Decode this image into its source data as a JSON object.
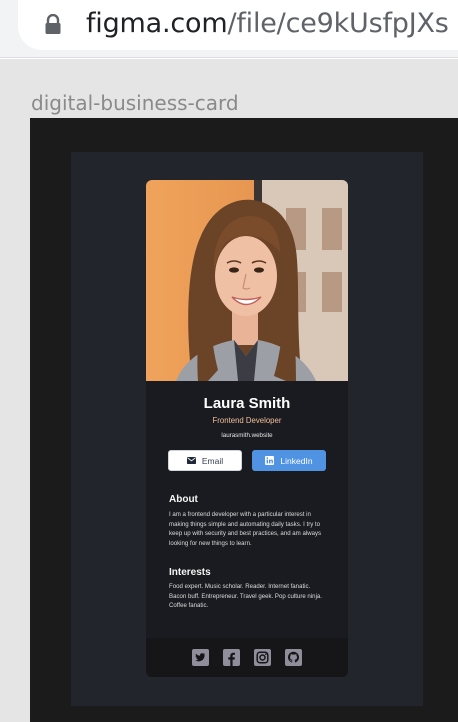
{
  "browser": {
    "url_host": "figma.com",
    "url_path": "/file/ce9kUsfpJXs"
  },
  "figma": {
    "frame_label": "digital-business-card"
  },
  "card": {
    "name": "Laura Smith",
    "title": "Frontend Developer",
    "website": "laurasmith.website",
    "email_label": "Email",
    "linkedin_label": "LinkedIn",
    "about_heading": "About",
    "about_text": "I am a frontend developer with a particular interest in making things simple and automating daily tasks. I try to keep up with security and best practices, and am always looking for new things to learn.",
    "interests_heading": "Interests",
    "interests_text": "Food expert. Music scholar. Reader. Internet fanatic. Bacon buff. Entrepreneur. Travel geek. Pop culture ninja. Coffee fanatic.",
    "social_icons": [
      "twitter-icon",
      "facebook-icon",
      "instagram-icon",
      "github-icon"
    ]
  },
  "colors": {
    "card_background": "#1a1b20",
    "title_accent": "#f3bf99",
    "linkedin_button": "#5093e2",
    "frame_background": "#23252c"
  }
}
